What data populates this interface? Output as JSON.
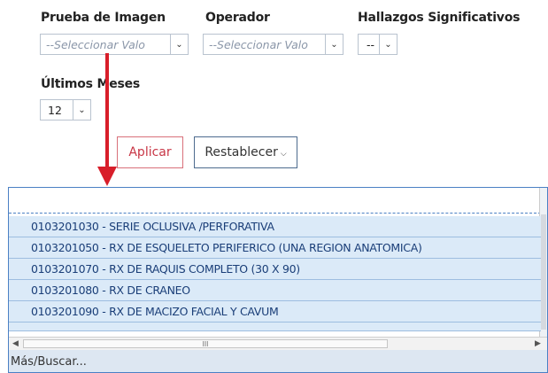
{
  "filters": {
    "prueba": {
      "label": "Prueba de Imagen",
      "value": "--Seleccionar Valo"
    },
    "operador": {
      "label": "Operador",
      "value": "--Seleccionar Valo"
    },
    "hallazgos": {
      "label": "Hallazgos Significativos",
      "value": "--"
    },
    "meses": {
      "label": "Últimos Meses",
      "value": "12"
    }
  },
  "buttons": {
    "apply": "Aplicar",
    "reset": "Restablecer"
  },
  "dropdown": {
    "items": [
      "0103201030 - SERIE OCLUSIVA /PERFORATIVA",
      "0103201050 - RX DE ESQUELETO PERIFERICO (UNA REGION ANATOMICA)",
      "0103201070 - RX DE RAQUIS COMPLETO (30 X 90)",
      "0103201080 - RX DE CRANEO",
      "0103201090 - RX DE MACIZO FACIAL Y CAVUM"
    ],
    "footer": "Más/Buscar...",
    "scroll_thumb": "III"
  },
  "colors": {
    "indicator": "#d81e2a",
    "list_bg": "#dbeaf8",
    "accent": "#4b80c4"
  },
  "icons": {
    "caret": "chevron-down-icon",
    "indicator": "red-arrow-pointer"
  }
}
